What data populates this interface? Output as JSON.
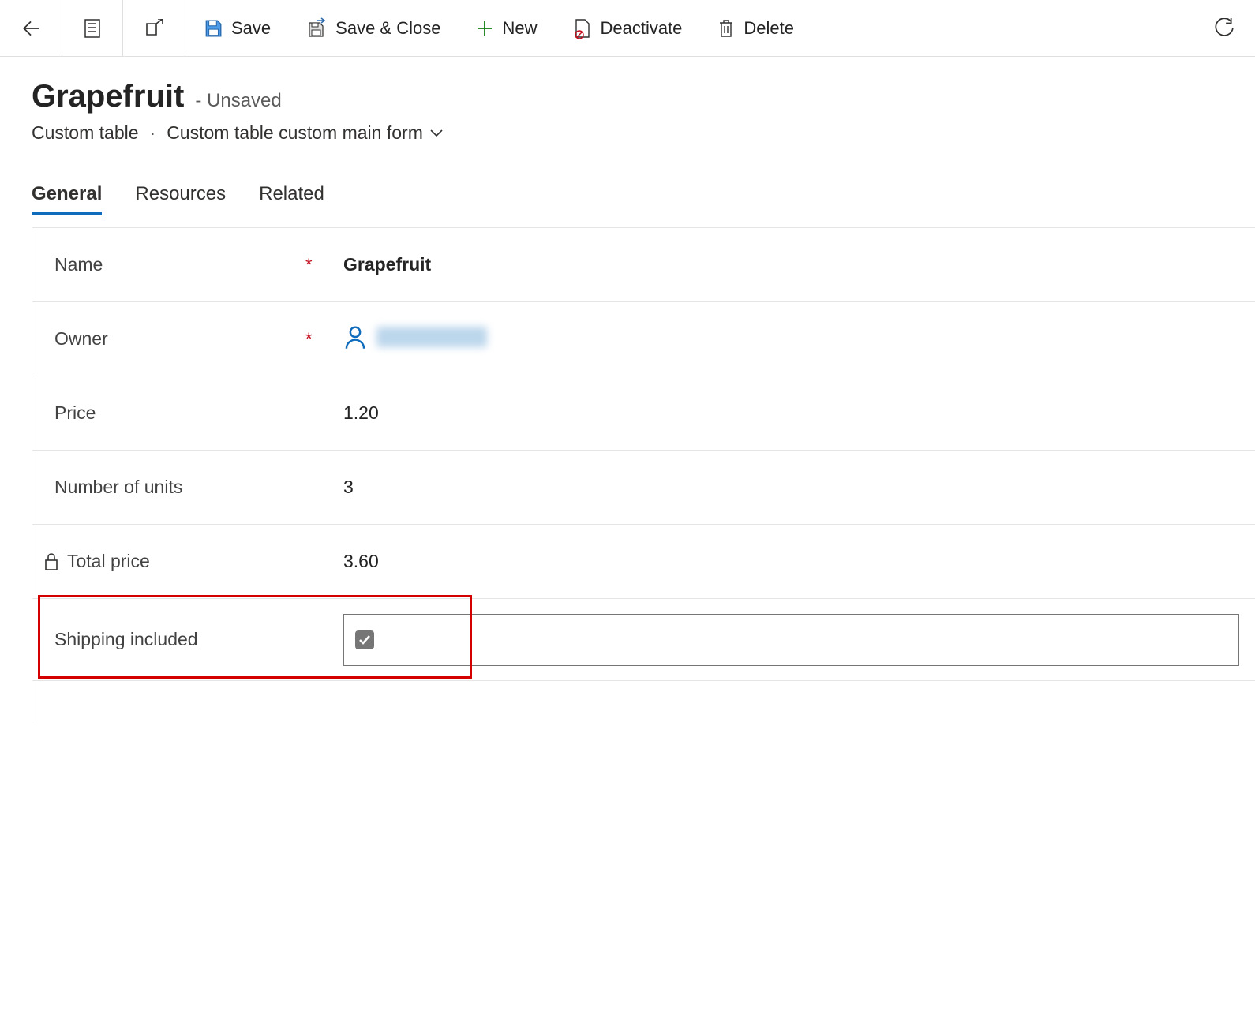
{
  "toolbar": {
    "save": "Save",
    "save_close": "Save & Close",
    "new": "New",
    "deactivate": "Deactivate",
    "delete": "Delete"
  },
  "header": {
    "title": "Grapefruit",
    "status": "- Unsaved",
    "entity": "Custom table",
    "form_name": "Custom table custom main form"
  },
  "tabs": {
    "general": "General",
    "resources": "Resources",
    "related": "Related"
  },
  "fields": {
    "name": {
      "label": "Name",
      "value": "Grapefruit",
      "required": "*"
    },
    "owner": {
      "label": "Owner",
      "required": "*"
    },
    "price": {
      "label": "Price",
      "value": "1.20"
    },
    "units": {
      "label": "Number of units",
      "value": "3"
    },
    "total": {
      "label": "Total price",
      "value": "3.60"
    },
    "shipping": {
      "label": "Shipping included",
      "checked": true
    }
  }
}
